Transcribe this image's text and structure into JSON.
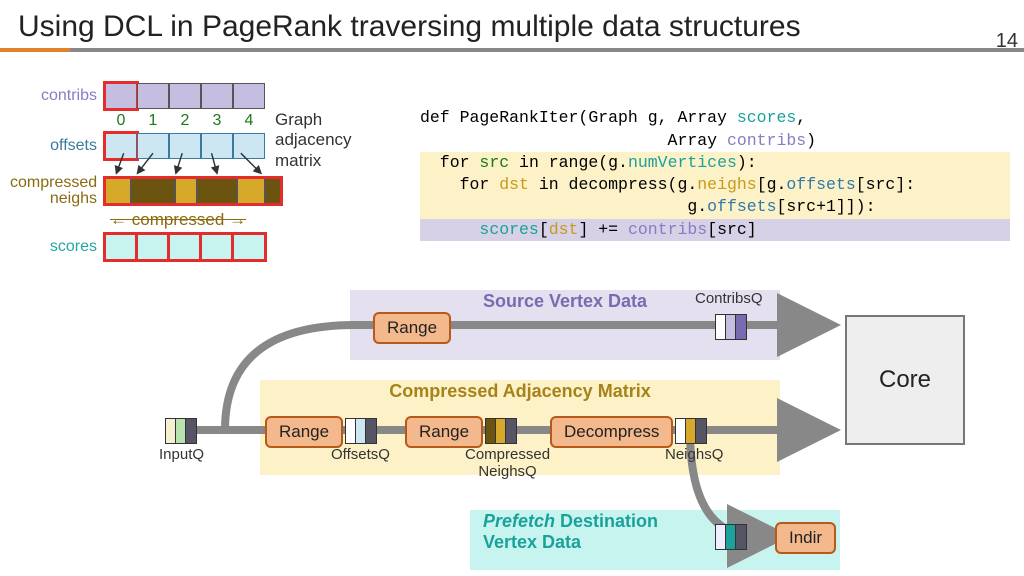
{
  "pageNumber": "14",
  "title": "Using DCL in PageRank traversing multiple data structures",
  "left": {
    "contribs": "contribs",
    "offsets": "offsets",
    "neighs": "compressed\nneighs",
    "scores": "scores",
    "indices": [
      "0",
      "1",
      "2",
      "3",
      "4"
    ],
    "graphLabel": "Graph\nadjacency\nmatrix",
    "compressed": "compressed"
  },
  "code": {
    "l1a": "def PageRankIter(Graph g, Array ",
    "l1b": "scores",
    "l1c": ",",
    "l2a": "                         Array ",
    "l2b": "contribs",
    "l2c": ")",
    "l3a": "  for ",
    "l3b": "src",
    "l3c": " in range(g.",
    "l3d": "numVertices",
    "l3e": "):",
    "l4a": "    for ",
    "l4b": "dst",
    "l4c": " in decompress(g.",
    "l4d": "neighs",
    "l4e": "[g.",
    "l4f": "offsets",
    "l4g": "[src]:",
    "l5a": "                           g.",
    "l5b": "offsets",
    "l5c": "[src+1]]):",
    "l6a": "      ",
    "l6b": "scores",
    "l6c": "[",
    "l6d": "dst",
    "l6e": "] += ",
    "l6f": "contribs",
    "l6g": "[src]"
  },
  "pipe": {
    "bandPu": "Source Vertex Data",
    "bandYe": "Compressed Adjacency Matrix",
    "bandCyPre": "Prefetch",
    "bandCyRest": " Destination\nVertex Data",
    "range": "Range",
    "decompress": "Decompress",
    "indir": "Indir",
    "core": "Core",
    "inputQ": "InputQ",
    "offsetsQ": "OffsetsQ",
    "compNeighsQ": "Compressed\nNeighsQ",
    "neighsQ": "NeighsQ",
    "contribsQ": "ContribsQ"
  }
}
